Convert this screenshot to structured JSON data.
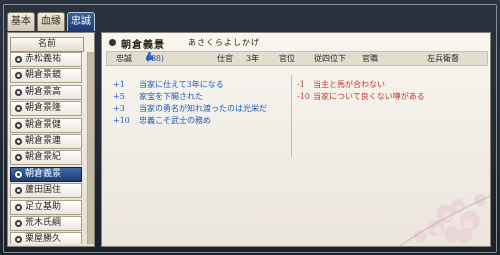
{
  "tabs": [
    {
      "label": "基本"
    },
    {
      "label": "血縁"
    },
    {
      "label": "忠誠",
      "active": true
    }
  ],
  "list_header": "名前",
  "officers": [
    {
      "name": "赤松義祐"
    },
    {
      "name": "朝倉景鏡"
    },
    {
      "name": "朝倉景高"
    },
    {
      "name": "朝倉景隆"
    },
    {
      "name": "朝倉景健"
    },
    {
      "name": "朝倉景連"
    },
    {
      "name": "朝倉景紀"
    },
    {
      "name": "朝倉義景",
      "selected": true
    },
    {
      "name": "蘆田国住"
    },
    {
      "name": "足立基助"
    },
    {
      "name": "荒木氏綱"
    },
    {
      "name": "栗屋勝久"
    }
  ],
  "header": {
    "officer_name": "朝倉義景",
    "reading": "あさくらよしかげ"
  },
  "stats": {
    "loyalty_label": "忠誠",
    "loyalty_value": "18",
    "loyalty_delta": "(+8)",
    "service_label": "仕官",
    "service_value": "3年",
    "rank_label": "官位",
    "rank_value": "従四位下",
    "office_label": "官職",
    "office_value": "左兵衛督"
  },
  "positive_factors": [
    {
      "value": "+1",
      "text": "当家に仕えて3年になる"
    },
    {
      "value": "+5",
      "text": "家宝を下賜された"
    },
    {
      "value": "+3",
      "text": "当家の勇名が知れ渡ったのは光栄だ"
    },
    {
      "value": "+10",
      "text": "忠義こそ武士の務め"
    }
  ],
  "negative_factors": [
    {
      "value": "-1",
      "text": "当主と馬が合わない"
    },
    {
      "value": "-10",
      "text": "当家について良くない噂がある"
    }
  ],
  "colors": {
    "positive": "#2057b7",
    "negative": "#c03a2b",
    "selected_row": "#1e3d73"
  }
}
